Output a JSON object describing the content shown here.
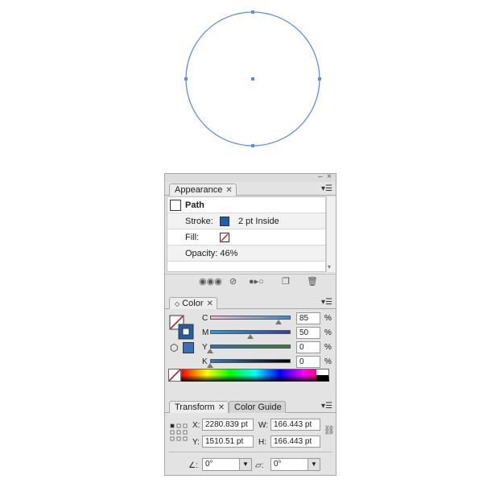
{
  "appearance": {
    "tab_label": "Appearance",
    "object_label": "Path",
    "stroke_label": "Stroke:",
    "stroke_value": "2 pt Inside",
    "fill_label": "Fill:",
    "opacity_text": "Opacity: 46%",
    "stroke_color": "#1f5fa8"
  },
  "color": {
    "tab_label": "Color",
    "channels": [
      {
        "label": "C",
        "value": "85",
        "percent": 85,
        "unit": "%"
      },
      {
        "label": "M",
        "value": "50",
        "percent": 50,
        "unit": "%"
      },
      {
        "label": "Y",
        "value": "0",
        "percent": 0,
        "unit": "%"
      },
      {
        "label": "K",
        "value": "0",
        "percent": 0,
        "unit": "%"
      }
    ],
    "stroke_swatch": "#1f5fa8"
  },
  "transform": {
    "tab_label": "Transform",
    "tab2_label": "Color Guide",
    "x_label": "X:",
    "x_value": "2280.839 pt",
    "y_label": "Y:",
    "y_value": "1510.51 pt",
    "w_label": "W:",
    "w_value": "166.443 pt",
    "h_label": "H:",
    "h_value": "166.443 pt",
    "rotate_value": "0°",
    "shear_value": "0°"
  },
  "canvas": {
    "selection_color": "#5b8fe0"
  }
}
